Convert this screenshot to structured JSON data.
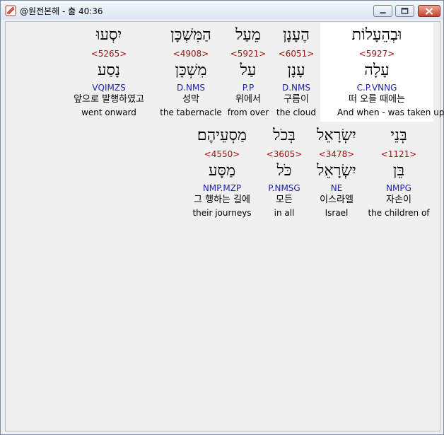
{
  "window": {
    "title": "@원전본해 - 출 40:36"
  },
  "rows": [
    [
      {
        "heb": "וּבְהֵעָלוֹת",
        "strong": "<5927>",
        "lemma": "עָלָה",
        "morph": "C.P.VNNG",
        "kor": "떠 오를 때에는",
        "eng": "And when - was taken up"
      },
      {
        "heb": "הֶעָנָן",
        "strong": "<6051>",
        "lemma": "עָנָן",
        "morph": "D.NMS",
        "kor": "구름이",
        "eng": "the cloud"
      },
      {
        "heb": "מֵעַל",
        "strong": "<5921>",
        "lemma": "עַל",
        "morph": "P.P",
        "kor": "위에서",
        "eng": "from over"
      },
      {
        "heb": "הַמִּשְׁכָּן",
        "strong": "<4908>",
        "lemma": "מִשְׁכָּן",
        "morph": "D.NMS",
        "kor": "성막",
        "eng": "the tabernacle"
      },
      {
        "heb": "יִסְעוּ",
        "strong": "<5265>",
        "lemma": "נָסַע",
        "morph": "VQIMZS",
        "kor": "앞으로 발행하였고",
        "eng": "went onward"
      }
    ],
    [
      {
        "heb": "בְּנֵי",
        "strong": "<1121>",
        "lemma": "בֵּן",
        "morph": "NMPG",
        "kor": "자손이",
        "eng": "the children of"
      },
      {
        "heb": "יִשְׂרָאֵל",
        "strong": "<3478>",
        "lemma": "יִשְׂרָאֵל",
        "morph": "NE",
        "kor": "이스라엘",
        "eng": "Israel"
      },
      {
        "heb": "בְּכֹל",
        "strong": "<3605>",
        "lemma": "כֹּל",
        "morph": "P.NMSG",
        "kor": "모든",
        "eng": "in all"
      },
      {
        "heb": "מַסְעֵיהֶם׃",
        "strong": "<4550>",
        "lemma": "מַסָּע",
        "morph": "NMP.MZP",
        "kor": "그 행하는 길에",
        "eng": "their journeys"
      }
    ]
  ]
}
